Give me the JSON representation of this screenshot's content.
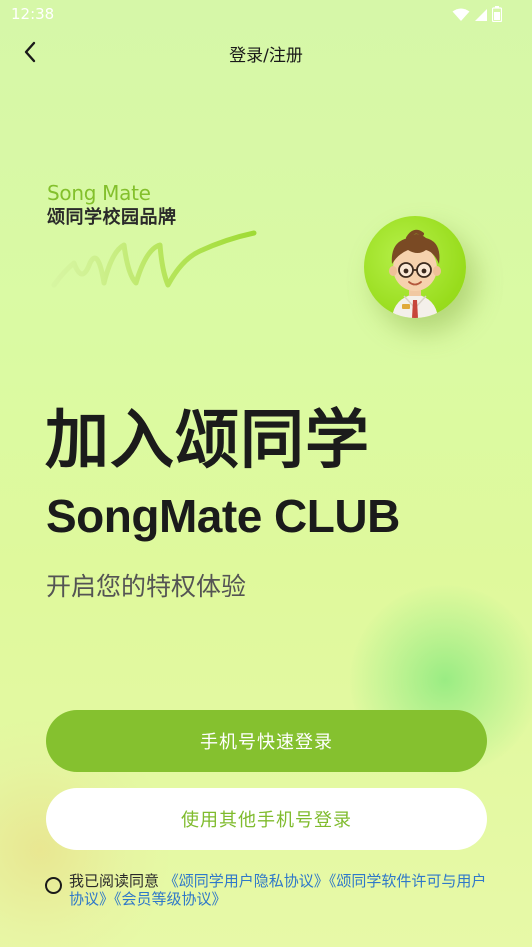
{
  "status_bar": {
    "time": "12:38",
    "icons": [
      "wifi-icon",
      "signal-icon",
      "battery-icon"
    ]
  },
  "nav": {
    "back_icon": "chevron-left-icon",
    "title": "登录/注册"
  },
  "brand": {
    "name_en": "Song Mate",
    "name_cn": "颂同学校园品牌"
  },
  "hero": {
    "headline": "加入颂同学",
    "subheadline": "SongMate CLUB",
    "tagline": "开启您的特权体验"
  },
  "actions": {
    "quick_login_label": "手机号快速登录",
    "other_phone_login_label": "使用其他手机号登录"
  },
  "agreement": {
    "prefix": "我已阅读同意",
    "link_privacy": "《颂同学用户隐私协议》",
    "link_license": "《颂同学软件许可与用户协议》",
    "link_membership": "《会员等级协议》"
  },
  "colors": {
    "accent": "#85c12f",
    "accent_text": "#7fbb2d",
    "brand_en": "#83c02c",
    "link": "#2f78c9",
    "background_top": "#d6f7a8"
  }
}
